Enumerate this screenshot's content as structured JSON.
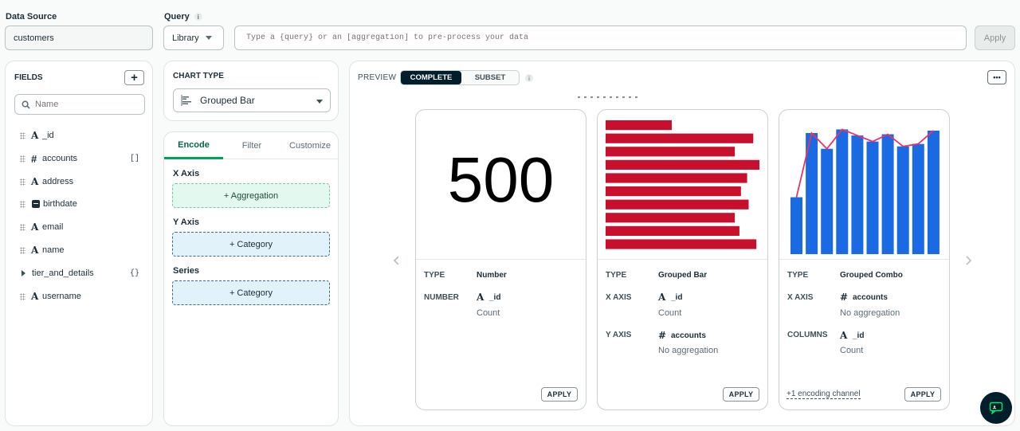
{
  "data_source": {
    "label": "Data Source",
    "value": "customers"
  },
  "query": {
    "label": "Query",
    "library_label": "Library",
    "placeholder": "Type a {query} or an [aggregation] to pre-process your data",
    "apply_label": "Apply"
  },
  "fields": {
    "title": "FIELDS",
    "search_placeholder": "Name",
    "items": [
      {
        "type": "A",
        "name": "_id",
        "suffix": ""
      },
      {
        "type": "#",
        "name": "accounts",
        "suffix": "[]"
      },
      {
        "type": "A",
        "name": "address",
        "suffix": ""
      },
      {
        "type": "date",
        "name": "birthdate",
        "suffix": ""
      },
      {
        "type": "A",
        "name": "email",
        "suffix": ""
      },
      {
        "type": "A",
        "name": "name",
        "suffix": ""
      },
      {
        "type": "obj",
        "name": "tier_and_details",
        "suffix": "{}"
      },
      {
        "type": "A",
        "name": "username",
        "suffix": ""
      }
    ]
  },
  "chart_type": {
    "title": "CHART TYPE",
    "selected": "Grouped Bar"
  },
  "encode": {
    "tabs": [
      "Encode",
      "Filter",
      "Customize"
    ],
    "active_tab": "Encode",
    "x_axis_label": "X Axis",
    "x_axis_drop": "+ Aggregation",
    "y_axis_label": "Y Axis",
    "y_axis_drop": "+ Category",
    "series_label": "Series",
    "series_drop": "+ Category"
  },
  "preview": {
    "label": "PREVIEW",
    "toggle": [
      "COMPLETE",
      "SUBSET"
    ],
    "active_toggle": "COMPLETE",
    "more_label": "•••"
  },
  "cards": [
    {
      "number": "500",
      "type_key": "TYPE",
      "type_val": "Number",
      "row1_key": "NUMBER",
      "row1_icon": "A",
      "row1_field": "_id",
      "row1_sub": "Count",
      "apply": "APPLY"
    },
    {
      "type_key": "TYPE",
      "type_val": "Grouped Bar",
      "row1_key": "X AXIS",
      "row1_icon": "A",
      "row1_field": "_id",
      "row1_sub": "Count",
      "row2_key": "Y AXIS",
      "row2_icon": "#",
      "row2_field": "accounts",
      "row2_sub": "No aggregation",
      "apply": "APPLY"
    },
    {
      "type_key": "TYPE",
      "type_val": "Grouped Combo",
      "row1_key": "X AXIS",
      "row1_icon": "#",
      "row1_field": "accounts",
      "row1_sub": "No aggregation",
      "row2_key": "COLUMNS",
      "row2_icon": "A",
      "row2_field": "_id",
      "row2_sub": "Count",
      "footnote": "+1 encoding channel",
      "apply": "APPLY"
    }
  ],
  "colors": {
    "accent_green": "#00684a",
    "bar_red": "#c8102e",
    "bar_blue": "#1a6ae4",
    "line_pink": "#e8336a",
    "dark": "#001e2b"
  },
  "chart_data": [
    {
      "type": "bar",
      "orientation": "horizontal",
      "values": [
        0.43,
        0.96,
        0.84,
        1.0,
        0.92,
        0.88,
        0.93,
        0.84,
        0.87,
        0.98
      ]
    },
    {
      "type": "combo",
      "bars": [
        0.47,
        1.0,
        0.87,
        1.03,
        0.98,
        0.93,
        0.99,
        0.89,
        0.91,
        1.02
      ],
      "line": [
        0.47,
        1.0,
        0.87,
        1.03,
        0.98,
        0.93,
        0.99,
        0.89,
        0.91,
        1.02
      ]
    }
  ]
}
